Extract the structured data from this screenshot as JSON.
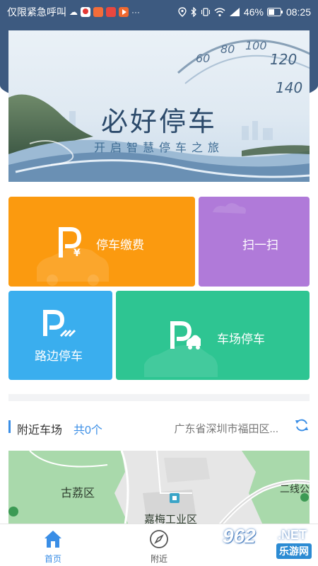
{
  "status_bar": {
    "left_text": "仅限紧急呼叫",
    "battery": "46%",
    "time": "08:25",
    "icons": [
      "cloud-icon",
      "map-pin-app-icon",
      "bird-app-icon",
      "game-app-icon",
      "play-app-icon",
      "more-dots-icon",
      "location-icon",
      "bluetooth-icon",
      "vibrate-icon",
      "wifi-icon",
      "signal-icon",
      "battery-icon"
    ]
  },
  "banner": {
    "title": "必好停车",
    "subtitle": "开启智慧停车之旅"
  },
  "features": {
    "pay": {
      "label": "停车缴费",
      "icon": "parking-yen-icon"
    },
    "scan": {
      "label": "扫一扫",
      "icon": "scan-icon"
    },
    "roadside": {
      "label": "路边停车",
      "icon": "parking-roadside-icon"
    },
    "lot": {
      "label": "车场停车",
      "icon": "parking-car-icon"
    }
  },
  "nearby": {
    "title": "附近车场",
    "count": "共0个",
    "address": "广东省深圳市福田区...",
    "refresh_icon": "refresh-icon"
  },
  "map": {
    "labels": [
      "古荔区",
      "嘉梅工业区",
      "二线公"
    ]
  },
  "bottom_nav": {
    "items": [
      {
        "label": "首页",
        "icon": "home-icon",
        "active": true
      },
      {
        "label": "附近",
        "icon": "compass-icon",
        "active": false
      }
    ]
  },
  "watermark": {
    "number": "962",
    "domain": ".NET",
    "name": "乐游网"
  },
  "colors": {
    "header": "#3d5a80",
    "orange": "#fb9a0f",
    "purple": "#b07ad9",
    "blue": "#3aaeee",
    "green": "#2ec592",
    "accent": "#3a8ee6"
  }
}
